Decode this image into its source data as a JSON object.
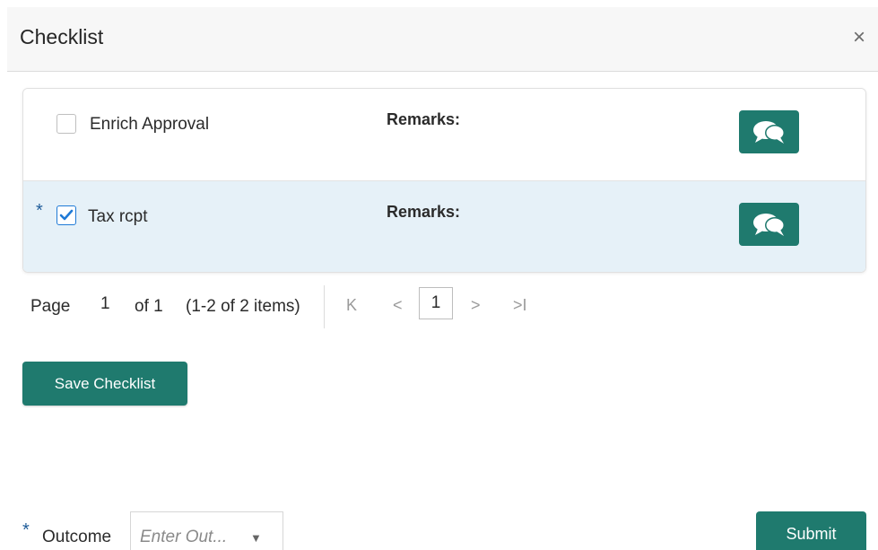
{
  "dialog": {
    "title": "Checklist",
    "close_glyph": "×"
  },
  "checklist": {
    "items": [
      {
        "label": "Enrich Approval",
        "required": false,
        "checked": false,
        "remarks_label": "Remarks:",
        "remark_icon": "chat-bubbles-icon"
      },
      {
        "label": "Tax rcpt",
        "required": true,
        "required_mark": "*",
        "checked": true,
        "remarks_label": "Remarks:",
        "remark_icon": "chat-bubbles-icon"
      }
    ]
  },
  "pager": {
    "page_word": "Page",
    "page_value": "1",
    "of_text": "of 1",
    "items_text": "(1-2 of 2 items)",
    "first_glyph": "K",
    "prev_glyph": "<",
    "current_page": "1",
    "next_glyph": ">",
    "last_glyph": ">I"
  },
  "actions": {
    "save_label": "Save Checklist",
    "submit_label": "Submit"
  },
  "outcome": {
    "required_mark": "*",
    "label": "Outcome",
    "placeholder": "Enter Out...",
    "caret": "▼"
  },
  "colors": {
    "accent": "#1f7a6e",
    "selected_row": "#e6f1f8",
    "required_star": "#1f5c99",
    "checkbox_checked": "#1f7ad6"
  }
}
